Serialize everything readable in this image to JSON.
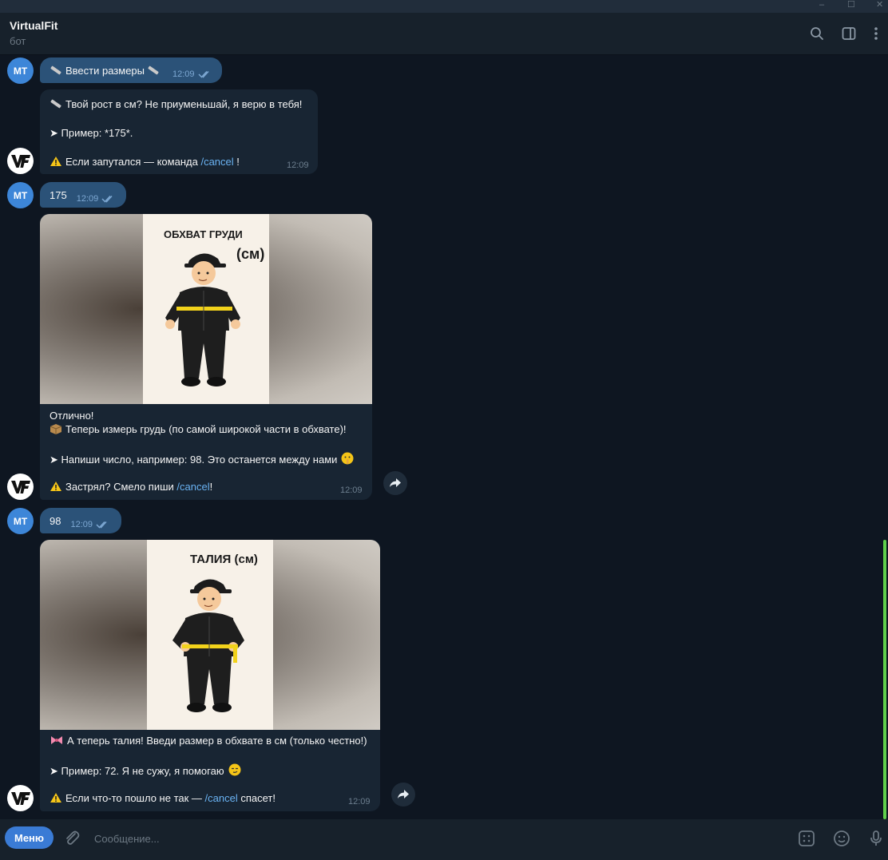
{
  "window": {
    "min": "–",
    "max": "☐",
    "close": "✕"
  },
  "header": {
    "title": "VirtualFit",
    "subtitle": "бот"
  },
  "avatars": {
    "user": "МТ"
  },
  "messages": [
    {
      "type": "out",
      "text": "Ввести размеры",
      "time": "12:09"
    },
    {
      "type": "in",
      "lines": [
        "Твой рост в см? Не приуменьшай, я верю в тебя!",
        "➤ Пример: *175*.",
        "Если запутался — команда ",
        "/cancel",
        " !"
      ],
      "time": "12:09"
    },
    {
      "type": "out",
      "text": "175",
      "time": "12:09"
    },
    {
      "type": "photo",
      "poster_title": "ОБХВАТ ГРУДИ",
      "poster_unit": "(см)",
      "lines": [
        "Отлично!",
        "Теперь измерь грудь (по самой широкой части в обхвате)!",
        "➤ Напиши число, например: 98. Это останется между нами",
        "Застрял? Смело пиши ",
        "/cancel",
        "!"
      ],
      "time": "12:09"
    },
    {
      "type": "out",
      "text": "98",
      "time": "12:09"
    },
    {
      "type": "photo",
      "poster_title": "ТАЛИЯ (см)",
      "lines": [
        "А теперь талия! Введи размер в обхвате в см (только честно!)",
        "➤ Пример: 72. Я не сужу, я помогаю",
        "Если что-то пошло не так — ",
        "/cancel",
        " спасет!"
      ],
      "time": "12:09"
    }
  ],
  "footer": {
    "menu_label": "Меню",
    "placeholder": "Сообщение..."
  },
  "colors": {
    "bg": "#0e1621",
    "outgoing": "#2b5278",
    "incoming": "#182533",
    "accent": "#3a7bd5",
    "link": "#6ab3f3"
  }
}
